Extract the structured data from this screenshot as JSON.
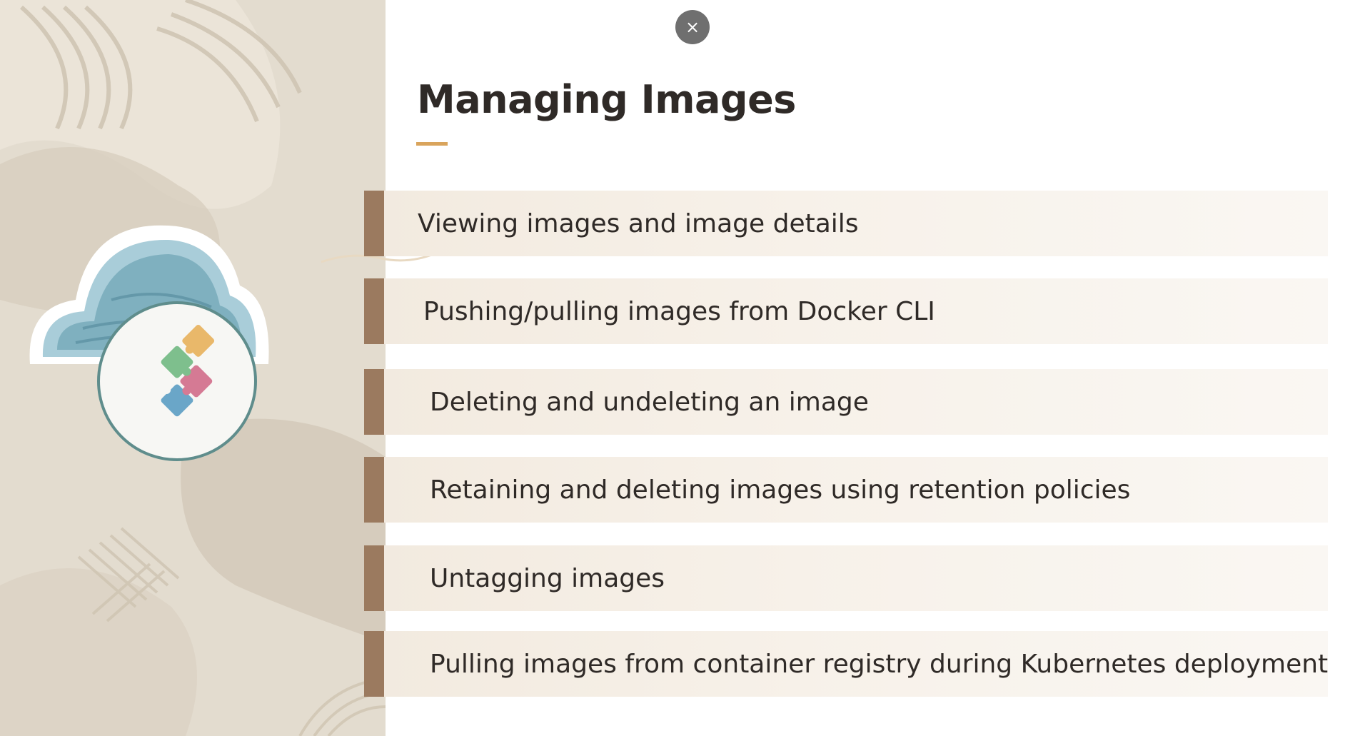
{
  "slide": {
    "title": "Managing Images",
    "close_label": "×",
    "accent_color": "#d9a45c",
    "bar_color": "#9b7a5f",
    "close_icon": "close-icon",
    "illustration_icon": "cloud-puzzle-icon"
  },
  "topics": [
    {
      "label": "Viewing images and image details"
    },
    {
      "label": "Pushing/pulling images from Docker CLI"
    },
    {
      "label": "Deleting and undeleting an image"
    },
    {
      "label": "Retaining and deleting images using retention policies"
    },
    {
      "label": "Untagging images"
    },
    {
      "label": "Pulling images from container registry during Kubernetes deployment"
    }
  ]
}
